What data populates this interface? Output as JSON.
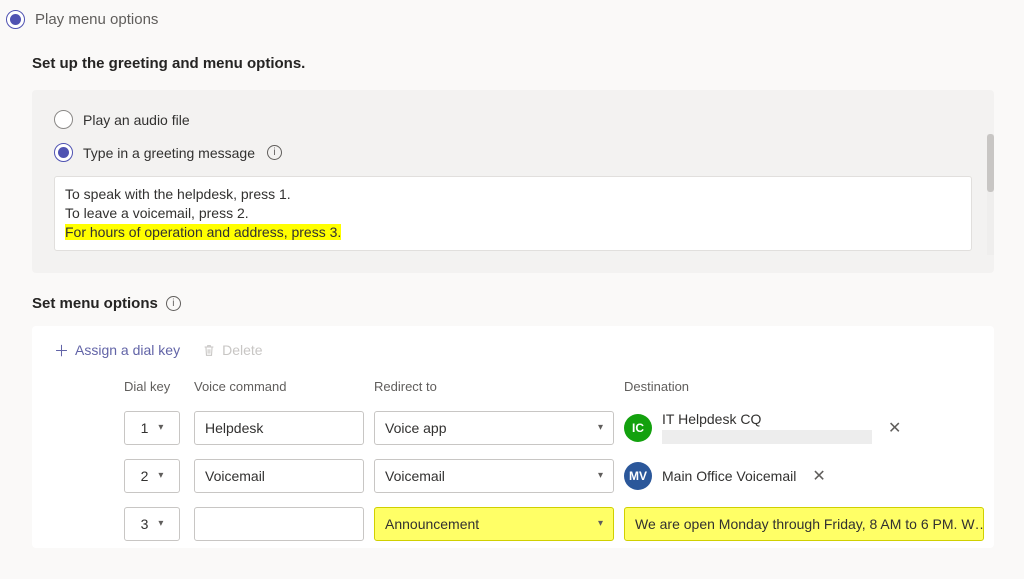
{
  "top_option_label": "Play menu options",
  "section_title": "Set up the greeting and menu options.",
  "greeting": {
    "audio_label": "Play an audio file",
    "type_label": "Type in a greeting message",
    "line1": "To speak with the helpdesk, press 1.",
    "line2": "To leave a voicemail, press 2.",
    "line3": "For hours of operation and address, press 3."
  },
  "menu": {
    "title": "Set menu options",
    "assign": "Assign a dial key",
    "delete": "Delete",
    "headers": {
      "dial": "Dial key",
      "vc": "Voice command",
      "rt": "Redirect to",
      "dest": "Destination"
    },
    "rows": {
      "r1": {
        "key": "1",
        "vc": "Helpdesk",
        "rt": "Voice app",
        "dest_initials": "IC",
        "dest_name": "IT Helpdesk CQ"
      },
      "r2": {
        "key": "2",
        "vc": "Voicemail",
        "rt": "Voicemail",
        "dest_initials": "MV",
        "dest_name": "Main Office Voicemail"
      },
      "r3": {
        "key": "3",
        "vc": "",
        "rt": "Announcement",
        "dest_text": "We are open Monday through Friday, 8 AM to 6 PM. W…"
      }
    }
  }
}
